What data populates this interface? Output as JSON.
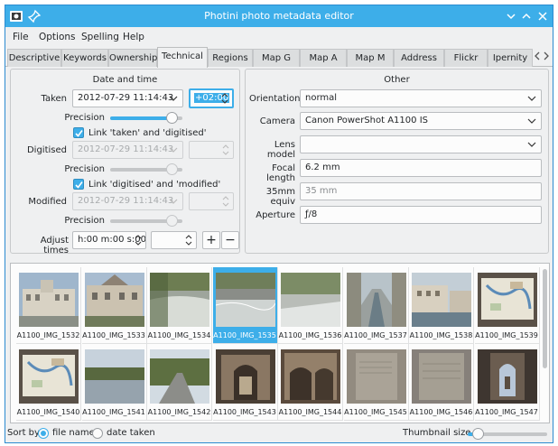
{
  "window": {
    "title": "Photini photo metadata editor"
  },
  "menu": [
    "File",
    "Options",
    "Spelling",
    "Help"
  ],
  "tabs": [
    {
      "label": "Descriptive",
      "active": false
    },
    {
      "label": "Keywords",
      "active": false
    },
    {
      "label": "Ownership",
      "active": false
    },
    {
      "label": "Technical",
      "active": true
    },
    {
      "label": "Regions",
      "active": false
    },
    {
      "label": "Map G",
      "active": false
    },
    {
      "label": "Map A",
      "active": false
    },
    {
      "label": "Map M",
      "active": false
    },
    {
      "label": "Address",
      "active": false
    },
    {
      "label": "Flickr",
      "active": false
    },
    {
      "label": "Ipernity",
      "active": false
    }
  ],
  "date_time": {
    "title": "Date and time",
    "taken": {
      "label": "Taken",
      "value": "2012-07-29 11:14:43",
      "offset": "+02:00",
      "precision_label": "Precision",
      "precision": 0.85
    },
    "link_taken_digitised": {
      "label": "Link 'taken' and 'digitised'",
      "checked": true
    },
    "digitised": {
      "label": "Digitised",
      "value": "2012-07-29 11:14:43",
      "precision_label": "Precision",
      "precision": 0.85
    },
    "link_digitised_modified": {
      "label": "Link 'digitised' and 'modified'",
      "checked": true
    },
    "modified": {
      "label": "Modified",
      "value": "2012-07-29 11:14:43",
      "precision_label": "Precision",
      "precision": 0.85
    },
    "adjust": {
      "label": "Adjust times",
      "value": "h:00 m:00 s:00",
      "plus": "+",
      "minus": "−"
    }
  },
  "other": {
    "title": "Other",
    "orientation": {
      "label": "Orientation",
      "value": "normal"
    },
    "camera": {
      "label": "Camera",
      "value": "Canon PowerShot A1100 IS"
    },
    "lens_model": {
      "label": "Lens model",
      "value": ""
    },
    "focal_length": {
      "label": "Focal length",
      "value": "6.2 mm"
    },
    "equiv": {
      "label": "35mm equiv",
      "value": "35 mm"
    },
    "aperture": {
      "label": "Aperture",
      "value": "ƒ/8"
    }
  },
  "thumbnails": [
    {
      "name": "A1100_IMG_1532",
      "selected": false,
      "scene": "building"
    },
    {
      "name": "A1100_IMG_1533",
      "selected": false,
      "scene": "building2"
    },
    {
      "name": "A1100_IMG_1534",
      "selected": false,
      "scene": "weir"
    },
    {
      "name": "A1100_IMG_1535",
      "selected": true,
      "scene": "river"
    },
    {
      "name": "A1100_IMG_1536",
      "selected": false,
      "scene": "river2"
    },
    {
      "name": "A1100_IMG_1537",
      "selected": false,
      "scene": "canal"
    },
    {
      "name": "A1100_IMG_1538",
      "selected": false,
      "scene": "street"
    },
    {
      "name": "A1100_IMG_1539",
      "selected": false,
      "scene": "map"
    },
    {
      "name": "A1100_IMG_1540",
      "selected": false,
      "scene": "map"
    },
    {
      "name": "A1100_IMG_1541",
      "selected": false,
      "scene": "lake"
    },
    {
      "name": "A1100_IMG_1542",
      "selected": false,
      "scene": "road"
    },
    {
      "name": "A1100_IMG_1543",
      "selected": false,
      "scene": "ruin"
    },
    {
      "name": "A1100_IMG_1544",
      "selected": false,
      "scene": "ruin2"
    },
    {
      "name": "A1100_IMG_1545",
      "selected": false,
      "scene": "stone"
    },
    {
      "name": "A1100_IMG_1546",
      "selected": false,
      "scene": "stone2"
    },
    {
      "name": "A1100_IMG_1547",
      "selected": false,
      "scene": "window"
    }
  ],
  "status": {
    "sort_by": "Sort by",
    "file_name": "file name",
    "date_taken": "date taken",
    "sort_selected": "file_name",
    "thumb_size_label": "Thumbnail size",
    "thumb_size": 0.12
  },
  "colors": {
    "accent": "#3daee9",
    "window_bg": "#eff0f1",
    "field_bg": "#fcfcfc"
  }
}
